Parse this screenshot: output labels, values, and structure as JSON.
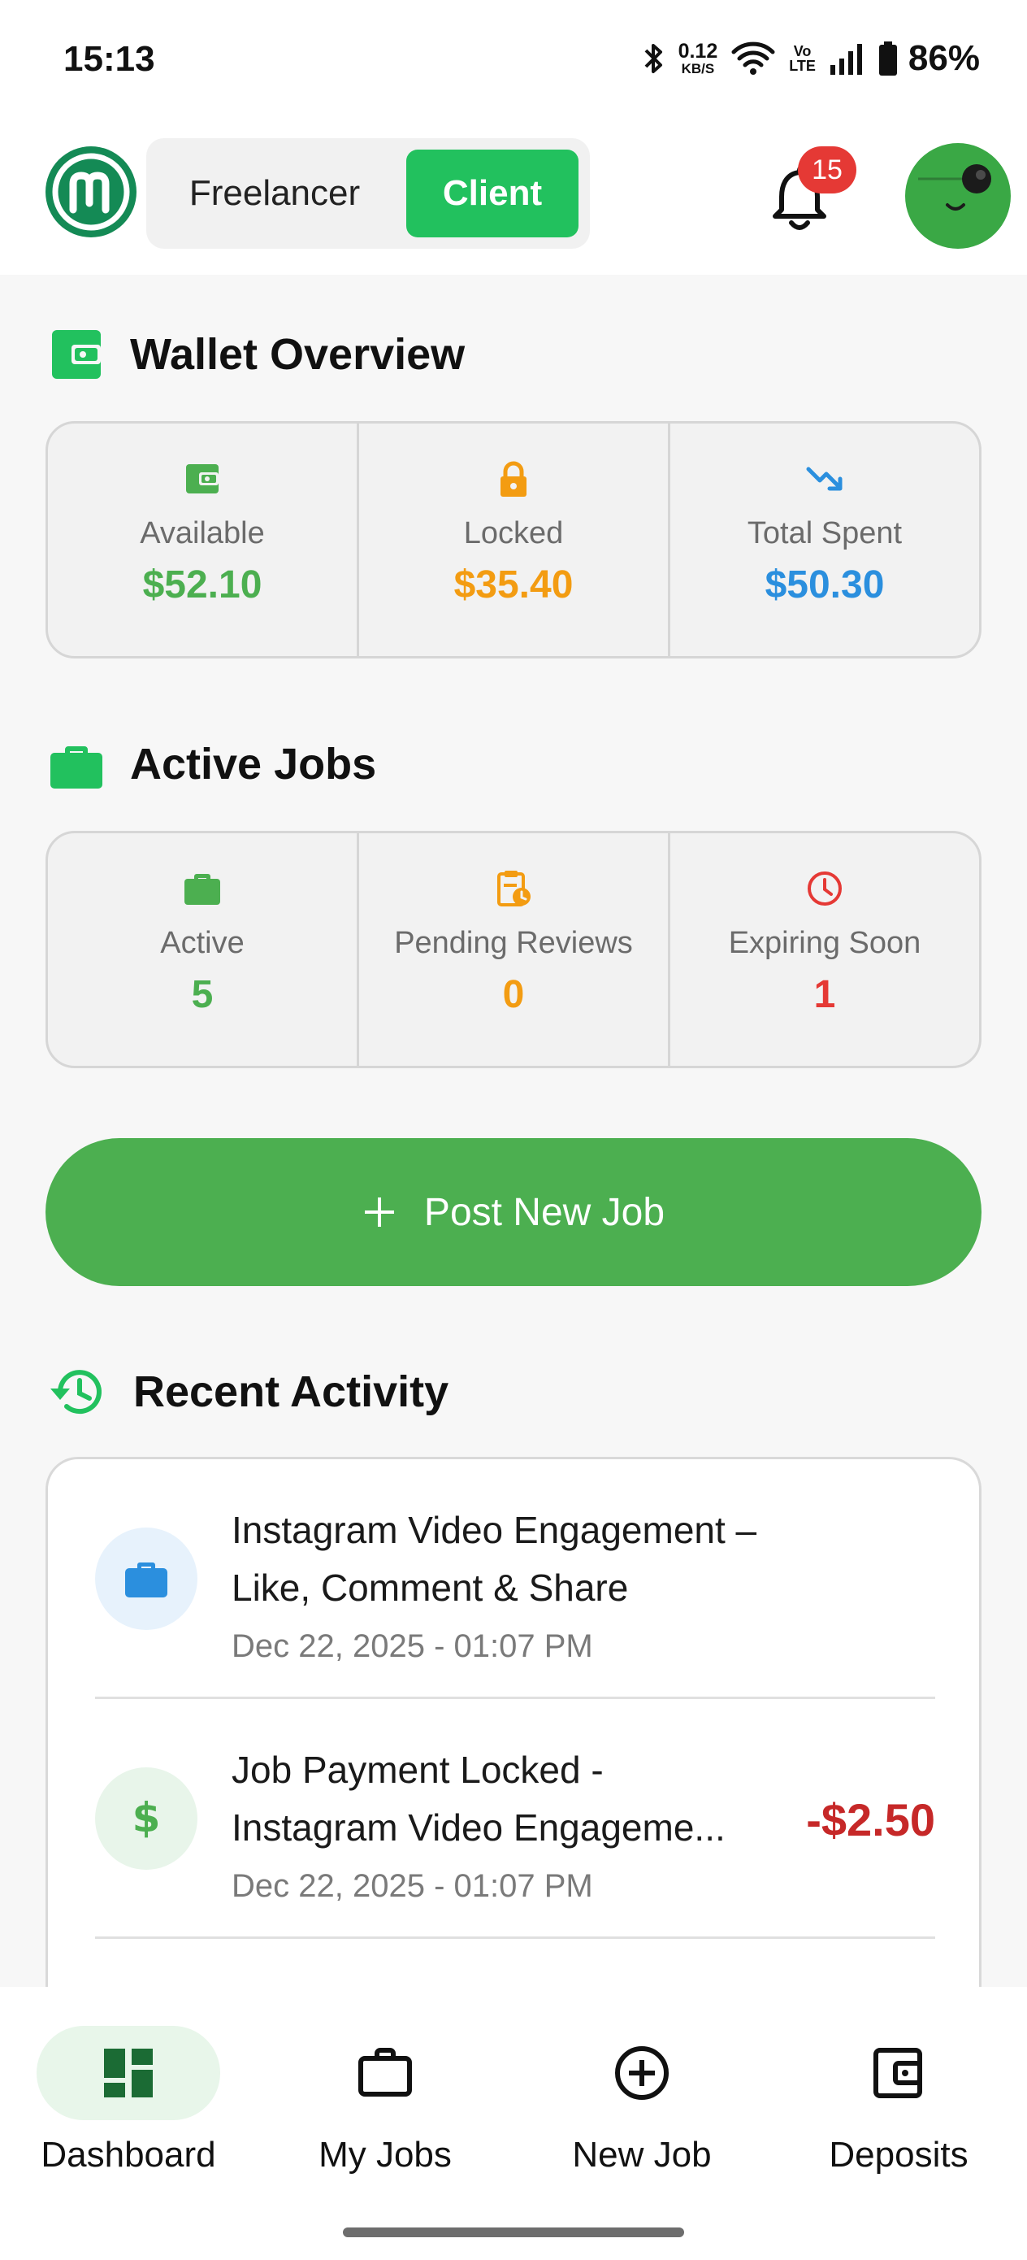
{
  "status_bar": {
    "time": "15:13",
    "net_speed_value": "0.12",
    "net_speed_unit": "KB/S",
    "volte_top": "Vo",
    "volte_bottom": "LTE",
    "battery": "86%",
    "icons": [
      "bluetooth-icon",
      "wifi-icon",
      "signal-icon",
      "battery-icon"
    ]
  },
  "header": {
    "role_options": [
      "Freelancer",
      "Client"
    ],
    "selected_role": "Client",
    "notification_count": "15"
  },
  "colors": {
    "brand_green": "#22c15e",
    "button_green": "#4caf50",
    "available": "#4caf50",
    "locked": "#f39c12",
    "spent": "#2b8fde",
    "expiring": "#e53935",
    "negative_amount": "#c62828"
  },
  "wallet": {
    "title": "Wallet Overview",
    "stats": [
      {
        "label": "Available",
        "value": "$52.10",
        "icon": "wallet-icon"
      },
      {
        "label": "Locked",
        "value": "$35.40",
        "icon": "lock-icon"
      },
      {
        "label": "Total Spent",
        "value": "$50.30",
        "icon": "trending-down-icon"
      }
    ]
  },
  "active_jobs": {
    "title": "Active Jobs",
    "stats": [
      {
        "label": "Active",
        "value": "5",
        "icon": "briefcase-icon"
      },
      {
        "label": "Pending Reviews",
        "value": "0",
        "icon": "clipboard-clock-icon"
      },
      {
        "label": "Expiring Soon",
        "value": "1",
        "icon": "clock-icon"
      }
    ]
  },
  "post_job": {
    "label": "Post New Job"
  },
  "recent_activity": {
    "title": "Recent Activity",
    "items": [
      {
        "title": "Instagram Video Engagement – Like, Comment & Share",
        "date": "Dec 22, 2025 - 01:07 PM",
        "amount": "",
        "icon": "briefcase-icon"
      },
      {
        "title": "Job Payment Locked - Instagram Video Engageme...",
        "date": "Dec 22, 2025 - 01:07 PM",
        "amount": "-$2.50",
        "icon": "dollar-icon"
      }
    ]
  },
  "bottom_nav": {
    "items": [
      {
        "label": "Dashboard",
        "icon": "dashboard-icon",
        "active": true
      },
      {
        "label": "My Jobs",
        "icon": "briefcase-outline-icon",
        "active": false
      },
      {
        "label": "New Job",
        "icon": "plus-circle-icon",
        "active": false
      },
      {
        "label": "Deposits",
        "icon": "wallet-outline-icon",
        "active": false
      }
    ]
  }
}
